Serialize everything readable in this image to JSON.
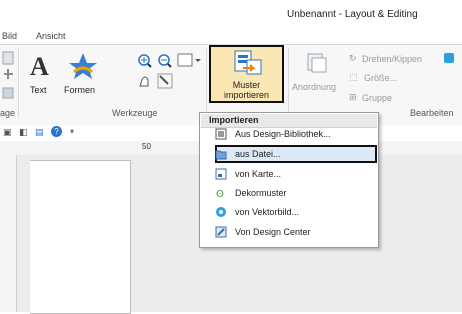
{
  "window": {
    "title": "Unbenannt - Layout & Editing"
  },
  "tabs": [
    "Bild",
    "Ansicht"
  ],
  "ribbon": {
    "text_label": "Text",
    "formen_label": "Formen",
    "werkzeuge_label": "Werkzeuge",
    "muster_label_1": "Muster",
    "muster_label_2": "importieren",
    "anordnung_label": "Anordnung",
    "drehen_label": "Drehen/Kippen",
    "groesse_label": "Größe...",
    "gruppe_label": "Gruppe",
    "bearbeiten_label": "Bearbeiten",
    "left_group_label": "age"
  },
  "ruler": {
    "mark_50": "50"
  },
  "menu": {
    "header": "Importieren",
    "items": [
      {
        "label": "Aus Design-Bibliothek...",
        "icon": "design-library-icon"
      },
      {
        "label": "aus Datei...",
        "icon": "folder-icon"
      },
      {
        "label": "von Karte...",
        "icon": "card-icon"
      },
      {
        "label": "Dekormuster",
        "icon": "decor-pattern-icon"
      },
      {
        "label": "von Vektorbild...",
        "icon": "vector-image-icon"
      },
      {
        "label": "Von Design Center",
        "icon": "design-center-icon"
      }
    ]
  },
  "colors": {
    "accent": "#2b73c4",
    "highlight": "#dce9f7",
    "selected_button": "#fbe7b4"
  }
}
